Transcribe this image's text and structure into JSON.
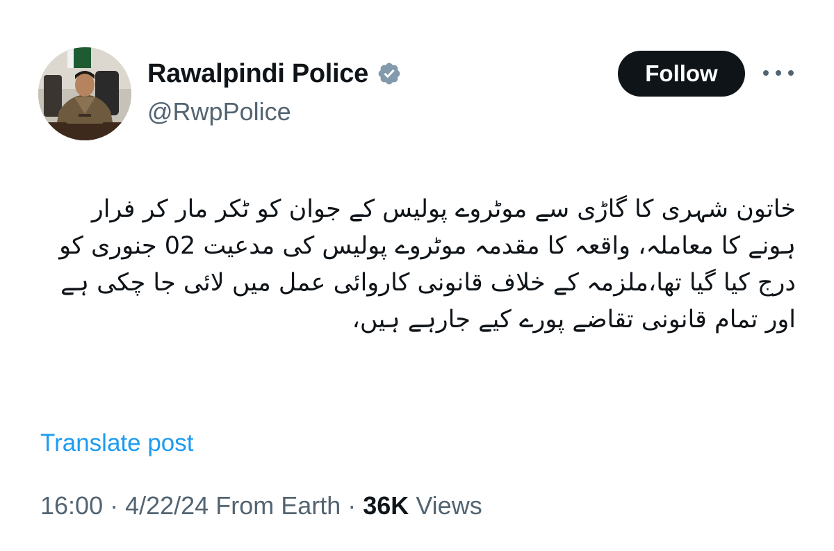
{
  "author": {
    "display_name": "Rawalpindi Police",
    "handle": "@RwpPolice",
    "verified_icon": "verified-badge-icon",
    "verified_color": "#829aab"
  },
  "actions": {
    "follow_label": "Follow",
    "more_icon": "more-horizontal-icon"
  },
  "post": {
    "lines": [
      "خاتون شہری کا گاڑی سے موٹروے پولیس کے جوان کو ٹکر مار کر فرار",
      "ہونے کا معاملہ، واقعہ کا مقدمہ موٹروے پولیس کی مدعیت 02 جنوری کو",
      "درج کیا گیا تھا،ملزمہ کے خلاف قانونی کاروائی عمل میں لائی جا چکی ہے",
      "اور تمام قانونی تقاضے پورے کیے جارہے ہیں،"
    ],
    "translate_label": "Translate post"
  },
  "meta": {
    "time": "16:00",
    "sep1": " · ",
    "date": "4/22/24",
    "source": " From Earth",
    "sep2": " · ",
    "views_count": "36K",
    "views_label": " Views"
  },
  "colors": {
    "text": "#0f1419",
    "secondary": "#536471",
    "link": "#1d9bf0",
    "button_bg": "#0f1419"
  }
}
